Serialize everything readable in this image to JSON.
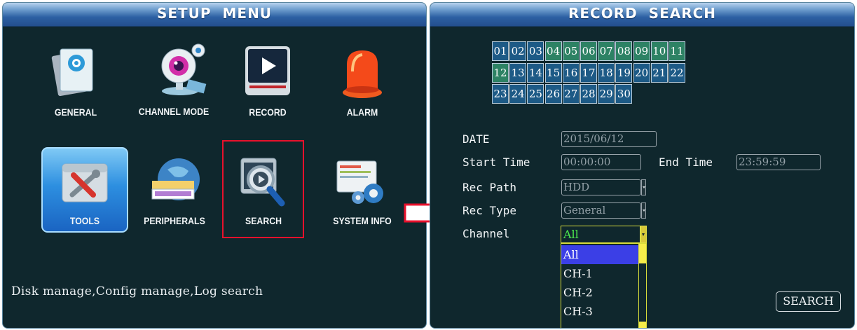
{
  "setup_menu": {
    "title": "SETUP  MENU",
    "items": [
      {
        "label": "GENERAL"
      },
      {
        "label": "CHANNEL MODE"
      },
      {
        "label": "RECORD"
      },
      {
        "label": "ALARM"
      },
      {
        "label": "TOOLS"
      },
      {
        "label": "PERIPHERALS"
      },
      {
        "label": "SEARCH"
      },
      {
        "label": "SYSTEM INFO"
      }
    ],
    "selected": "TOOLS",
    "highlighted": "SEARCH",
    "status_text": "Disk manage,Config manage,Log search"
  },
  "record_search": {
    "title": "RECORD  SEARCH",
    "days": [
      "01",
      "02",
      "03",
      "04",
      "05",
      "06",
      "07",
      "08",
      "09",
      "10",
      "11",
      "12",
      "13",
      "14",
      "15",
      "16",
      "17",
      "18",
      "19",
      "20",
      "21",
      "22",
      "23",
      "24",
      "25",
      "26",
      "27",
      "28",
      "29",
      "30"
    ],
    "days_with_records": [
      "04",
      "05",
      "06",
      "07",
      "08",
      "09",
      "10",
      "11",
      "12"
    ],
    "date_label": "DATE",
    "date_value": "2015/06/12",
    "start_time_label": "Start Time",
    "start_time_value": "00:00:00",
    "end_time_label": "End Time",
    "end_time_value": "23:59:59",
    "rec_path_label": "Rec Path",
    "rec_path_value": "HDD",
    "rec_type_label": "Rec Type",
    "rec_type_value": "General",
    "channel_label": "Channel",
    "channel_value": "All",
    "channel_options": [
      "All",
      "CH-1",
      "CH-2",
      "CH-3"
    ],
    "search_button": "SEARCH"
  },
  "colors": {
    "panel_bg": "#0f272d",
    "title_blue": "#2c60a3",
    "day_blue": "#1d5a86",
    "day_green": "#2d8264",
    "highlight_red": "#e8112c",
    "dropdown_selection": "#3b3fe6",
    "channel_text": "#4dea4d"
  }
}
